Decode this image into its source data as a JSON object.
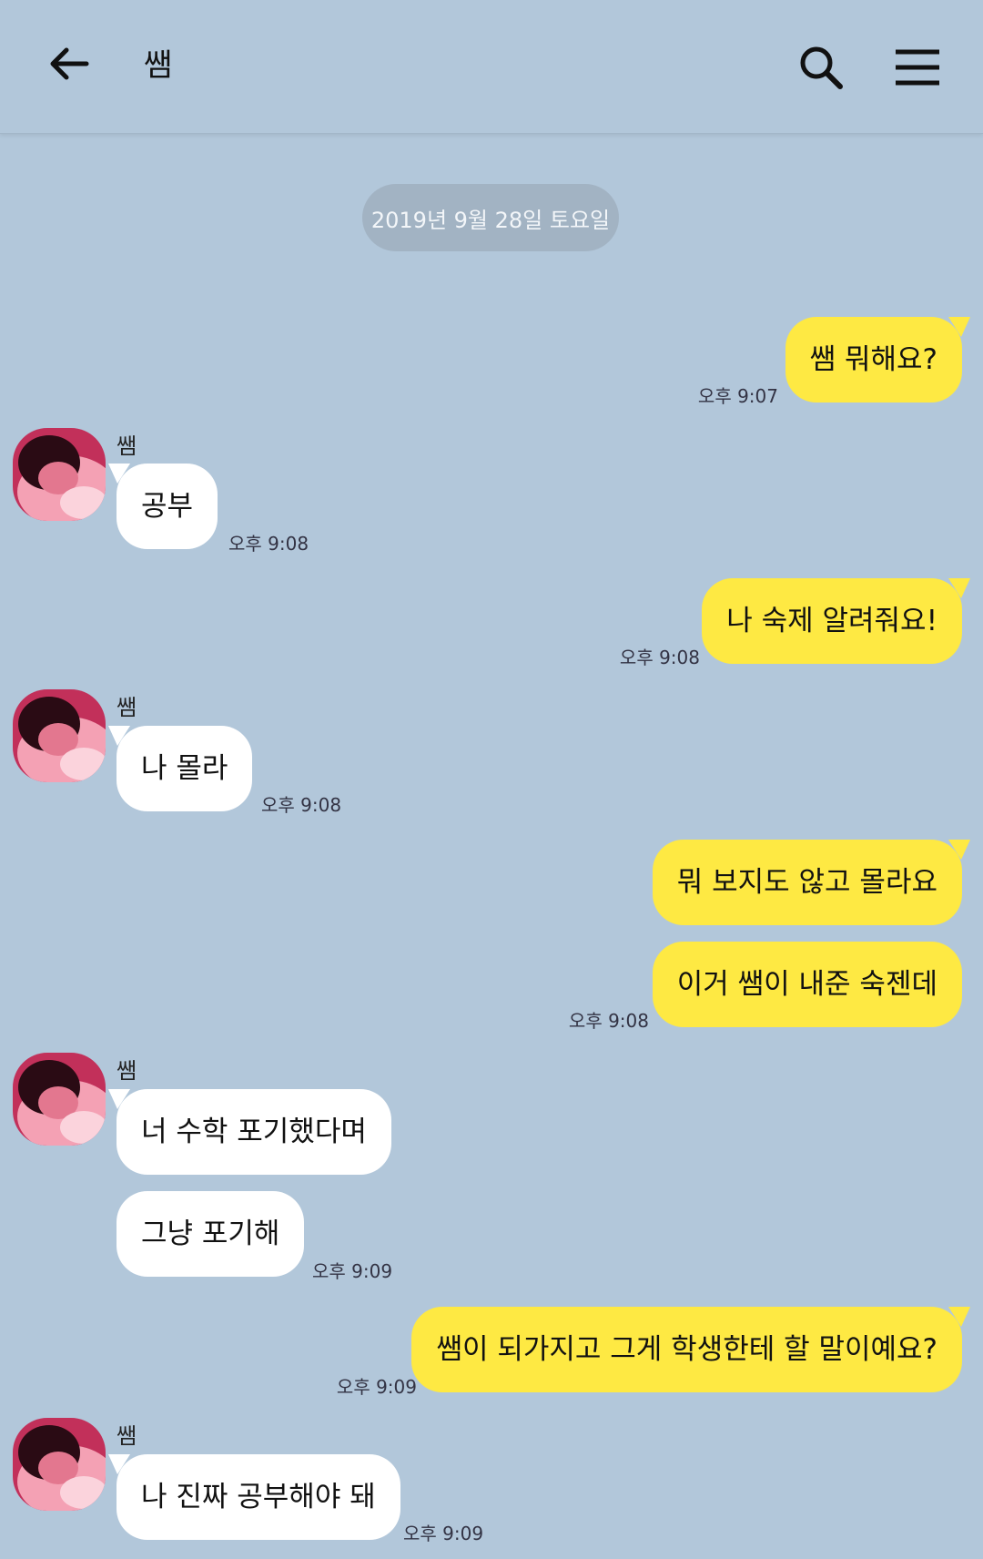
{
  "header": {
    "title": "쌤",
    "back_icon": "arrow-left-icon",
    "search_icon": "search-icon",
    "menu_icon": "hamburger-menu-icon"
  },
  "date_divider": "2019년 9월 28일 토요일",
  "colors": {
    "background": "#b2c7da",
    "my_bubble": "#fee943",
    "their_bubble": "#ffffff"
  },
  "messages": [
    {
      "from": "me",
      "text": "쌤 뭐해요?",
      "time": "오후 9:07"
    },
    {
      "from": "쌤",
      "text": "공부",
      "time": "오후 9:08"
    },
    {
      "from": "me",
      "text": "나 숙제 알려줘요!",
      "time": "오후 9:08"
    },
    {
      "from": "쌤",
      "text": "나 몰라",
      "time": "오후 9:08"
    },
    {
      "from": "me",
      "text": "뭐 보지도 않고 몰라요"
    },
    {
      "from": "me",
      "text": "이거 쌤이 내준 숙젠데",
      "time": "오후 9:08"
    },
    {
      "from": "쌤",
      "text": "너 수학 포기했다며"
    },
    {
      "from": "쌤",
      "text": "그냥 포기해",
      "time": "오후 9:09"
    },
    {
      "from": "me",
      "text": "쌤이 되가지고 그게 학생한테 할 말이예요?",
      "time": "오후 9:09"
    },
    {
      "from": "쌤",
      "text": "나 진짜 공부해야 돼",
      "time": "오후 9:09"
    }
  ],
  "sender_names": [
    "쌤",
    "쌤",
    "쌤",
    "쌤"
  ]
}
